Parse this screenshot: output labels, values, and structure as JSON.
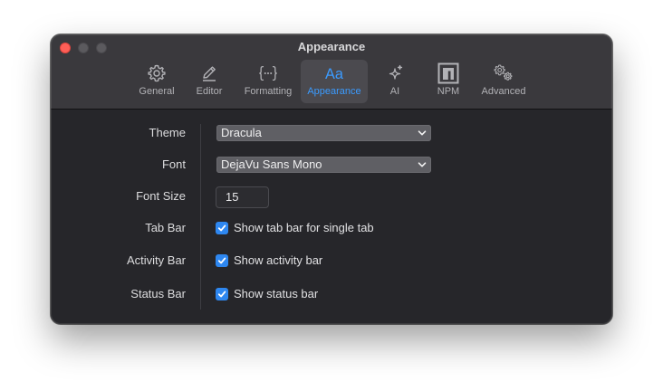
{
  "window": {
    "title": "Appearance"
  },
  "toolbar": {
    "tabs": [
      {
        "label": "General",
        "icon": "gear-icon"
      },
      {
        "label": "Editor",
        "icon": "pencil-icon"
      },
      {
        "label": "Formatting",
        "icon": "braces-icon"
      },
      {
        "label": "Appearance",
        "icon": "text-aa-icon",
        "selected": true
      },
      {
        "label": "AI",
        "icon": "sparkles-icon"
      },
      {
        "label": "NPM",
        "icon": "npm-logo-icon"
      },
      {
        "label": "Advanced",
        "icon": "gears-icon"
      }
    ],
    "accent_color": "#3b9bff"
  },
  "settings": {
    "theme": {
      "label": "Theme",
      "value": "Dracula"
    },
    "font": {
      "label": "Font",
      "value": "DejaVu Sans Mono"
    },
    "font_size": {
      "label": "Font Size",
      "value": "15"
    },
    "tab_bar": {
      "label": "Tab Bar",
      "option": "Show tab bar for single tab",
      "checked": true
    },
    "activity_bar": {
      "label": "Activity Bar",
      "option": "Show activity bar",
      "checked": true
    },
    "status_bar": {
      "label": "Status Bar",
      "option": "Show status bar",
      "checked": true
    }
  },
  "colors": {
    "close_button": "#fe5f57",
    "checkbox_fill": "#2e87f0",
    "window_background": "#26262a",
    "toolbar_background": "#3a393d"
  }
}
